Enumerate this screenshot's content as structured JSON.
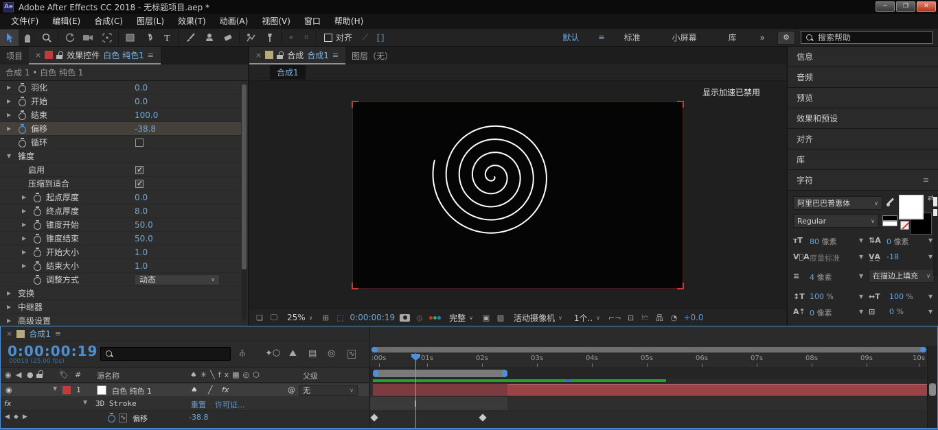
{
  "window": {
    "logo": "Ae",
    "title": "Adobe After Effects CC 2018 - 无标题项目.aep *"
  },
  "menu": {
    "items": [
      "文件(F)",
      "编辑(E)",
      "合成(C)",
      "图层(L)",
      "效果(T)",
      "动画(A)",
      "视图(V)",
      "窗口",
      "帮助(H)"
    ]
  },
  "toolbar": {
    "snap_label": "对齐",
    "workspaces": {
      "active": "默认",
      "items": [
        "标准",
        "小屏幕",
        "库"
      ],
      "overflow": "»"
    },
    "search_placeholder": "搜索帮助"
  },
  "effect_controls": {
    "tab_project": "项目",
    "tab_title": "效果控件",
    "tab_target": "白色 纯色1",
    "breadcrumb": "合成 1 • 白色 纯色 1",
    "rows": [
      {
        "label": "羽化",
        "value": "0.0"
      },
      {
        "label": "开始",
        "value": "0.0"
      },
      {
        "label": "结束",
        "value": "100.0"
      },
      {
        "label": "偏移",
        "value": "-38.8"
      },
      {
        "label": "循环",
        "value": "unchecked"
      },
      {
        "label": "锥度"
      },
      {
        "label": "启用",
        "value": "checked"
      },
      {
        "label": "压缩到适合",
        "value": "checked"
      },
      {
        "label": "起点厚度",
        "value": "0.0"
      },
      {
        "label": "终点厚度",
        "value": "8.0"
      },
      {
        "label": "锥度开始",
        "value": "50.0"
      },
      {
        "label": "锥度结束",
        "value": "50.0"
      },
      {
        "label": "开始大小",
        "value": "1.0"
      },
      {
        "label": "结束大小",
        "value": "1.0"
      },
      {
        "label": "调整方式",
        "value": "动态"
      },
      {
        "label": "变换"
      },
      {
        "label": "中继器"
      },
      {
        "label": "高级设置"
      }
    ]
  },
  "viewer": {
    "comp_label": "合成",
    "comp_name": "合成1",
    "layer_tab": "图层（无）",
    "breadcrumb": "合成1",
    "overlay_message": "显示加速已禁用",
    "zoom": "25%",
    "timecode": "0:00:00:19",
    "resolution": "完整",
    "camera": "活动摄像机",
    "view_count": "1个..",
    "exposure": "+0.0"
  },
  "right_panel": {
    "panels": [
      "信息",
      "音频",
      "预览",
      "效果和预设",
      "对齐",
      "库"
    ],
    "character": {
      "title": "字符",
      "font_family": "阿里巴巴普惠体",
      "font_style": "Regular",
      "font_size": "80",
      "font_size_unit": "像素",
      "leading": "0",
      "leading_unit": "像素",
      "kerning": "度量标准",
      "tracking": "-18",
      "stroke_width": "4",
      "stroke_width_unit": "像素",
      "fill_mode": "在描边上填充",
      "vertical_scale": "100",
      "vertical_scale_unit": "%",
      "horizontal_scale": "100",
      "horizontal_scale_unit": "%",
      "baseline_shift": "0",
      "baseline_shift_unit": "像素",
      "tsume": "0",
      "tsume_unit": "%"
    }
  },
  "timeline": {
    "tab": "合成1",
    "timecode": "0:00:00:19",
    "frame_info": "00019 (25.00 fps)",
    "columns": {
      "source_name": "源名称",
      "parent": "父级"
    },
    "layer": {
      "index": "1",
      "name": "白色 纯色 1",
      "parent_value": "无"
    },
    "effect": {
      "badge": "fx",
      "name": "3D Stroke",
      "reset_link": "重置",
      "license_link": "许可证..."
    },
    "property": {
      "name": "偏移",
      "value": "-38.8"
    },
    "ruler": [
      ":00s",
      "01s",
      "02s",
      "03s",
      "04s",
      "05s",
      "06s",
      "07s",
      "08s",
      "09s",
      "10s"
    ]
  },
  "colors": {
    "accent_blue": "#4f8fd5",
    "value_blue": "#6fa8d8",
    "layer_label_red": "#c23b3b",
    "render_green": "#1fa32a",
    "layer_bar_red": "#9b4247"
  }
}
